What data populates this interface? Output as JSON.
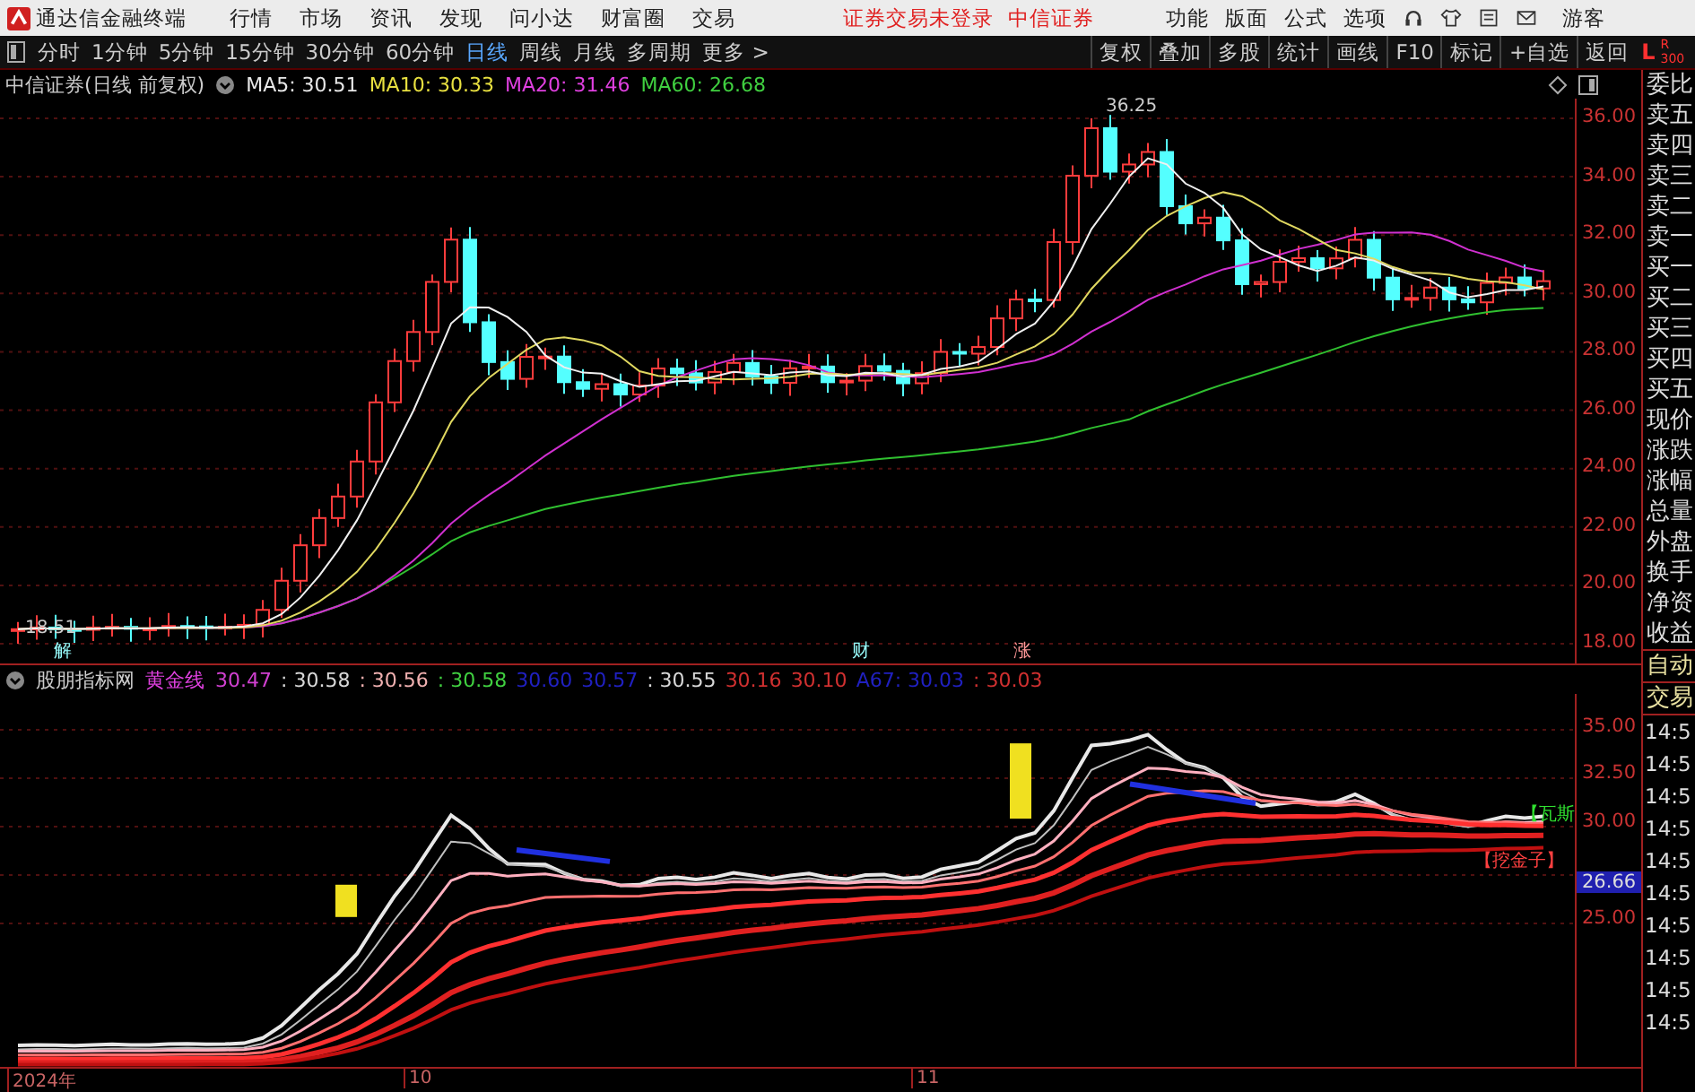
{
  "menu_bar": {
    "title": "通达信金融终端",
    "menus": [
      "行情",
      "市场",
      "资讯",
      "发现",
      "问小达",
      "财富圈",
      "交易"
    ],
    "status": [
      "证券交易未登录",
      "中信证券"
    ],
    "actions": [
      "功能",
      "版面",
      "公式",
      "选项"
    ],
    "user": "游客"
  },
  "toolbar": {
    "periods": [
      {
        "label": "分时",
        "selected": false
      },
      {
        "label": "1分钟",
        "selected": false
      },
      {
        "label": "5分钟",
        "selected": false
      },
      {
        "label": "15分钟",
        "selected": false
      },
      {
        "label": "30分钟",
        "selected": false
      },
      {
        "label": "60分钟",
        "selected": false
      },
      {
        "label": "日线",
        "selected": true
      },
      {
        "label": "周线",
        "selected": false
      },
      {
        "label": "月线",
        "selected": false
      },
      {
        "label": "多周期",
        "selected": false
      },
      {
        "label": "更多 >",
        "selected": false
      }
    ],
    "tools": [
      "复权",
      "叠加",
      "多股",
      "统计",
      "画线",
      "F10",
      "标记",
      "+自选",
      "返回"
    ],
    "corner": [
      "L",
      "R",
      "300"
    ]
  },
  "price_chart": {
    "title": "中信证券(日线 前复权)",
    "legend": [
      {
        "text": "MA5: 30.51",
        "color": "#e8e8e8"
      },
      {
        "text": "MA10: 30.33",
        "color": "#e8e040"
      },
      {
        "text": "MA20: 31.46",
        "color": "#e040e0"
      },
      {
        "text": "MA60: 26.68",
        "color": "#40d040"
      }
    ],
    "yticks": [
      "36.00",
      "34.00",
      "32.00",
      "30.00",
      "28.00",
      "26.00",
      "24.00",
      "22.00",
      "20.00",
      "18.00"
    ],
    "high_label": "36.25",
    "low_label": "18.51",
    "markers": [
      "解",
      "财",
      "涨"
    ]
  },
  "indicator": {
    "title": "股朋指标网",
    "name": "黄金线",
    "values": [
      {
        "text": "30.47",
        "color": "#d040d0"
      },
      {
        "text": ": 30.58",
        "color": "#d8d8d8"
      },
      {
        "text": ": 30.56",
        "color": "#f0b0b0"
      },
      {
        "text": ": 30.58",
        "color": "#40d040"
      },
      {
        "text": "30.60",
        "color": "#2020c0"
      },
      {
        "text": "30.57",
        "color": "#2020c0"
      },
      {
        "text": ": 30.55",
        "color": "#d8d8d8"
      },
      {
        "text": "30.16",
        "color": "#d03030"
      },
      {
        "text": "30.10",
        "color": "#d03030"
      },
      {
        "text": "A67: 30.03",
        "color": "#2020c0"
      },
      {
        "text": ": 30.03",
        "color": "#d03030"
      }
    ],
    "yticks": [
      "35.00",
      "32.50",
      "30.00",
      "25.00"
    ],
    "current": "26.66",
    "signals": [
      "【瓦斯",
      "【挖金子】"
    ]
  },
  "time_axis": [
    "2024年",
    "10",
    "11"
  ],
  "side_panel": {
    "quote_labels": [
      "委比",
      "卖五",
      "卖四",
      "卖三",
      "卖二",
      "卖一",
      "买一",
      "买二",
      "买三",
      "买四",
      "买五",
      "现价",
      "涨跌",
      "涨幅",
      "总量",
      "外盘",
      "换手",
      "净资",
      "收益"
    ],
    "trade_labels": [
      "自动",
      "交易"
    ],
    "times": [
      "14:5",
      "14:5",
      "14:5",
      "14:5",
      "14:5",
      "14:5",
      "14:5",
      "14:5",
      "14:5",
      "14:5"
    ]
  }
}
